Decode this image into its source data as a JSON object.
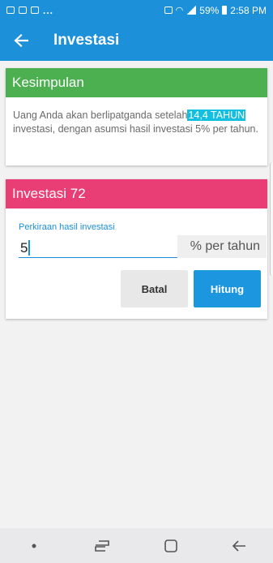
{
  "status_bar": {
    "notification_dots": "...",
    "battery_percent": "59%",
    "time": "2:58 PM"
  },
  "app_bar": {
    "title": "Investasi",
    "back_icon": "arrow-left-icon"
  },
  "summary_card": {
    "title": "Kesimpulan",
    "text_before": "Uang Anda akan berlipatganda setelah",
    "highlight": "14,4 TAHUN",
    "text_after": " investasi, dengan asumsi hasil investasi 5% per tahun."
  },
  "calc_card": {
    "title": "Investasi 72",
    "input_label": "Perkiraan hasil investasi",
    "input_value": "5",
    "suffix": "% per tahun",
    "cancel_label": "Batal",
    "submit_label": "Hitung"
  },
  "colors": {
    "primary": "#1c90d8",
    "green_header": "#4cb051",
    "pink_header": "#e93d75",
    "highlight": "#12bfe0"
  },
  "nav_bar": {
    "items": [
      "dot-icon",
      "recent-apps-icon",
      "home-icon",
      "back-icon"
    ]
  }
}
